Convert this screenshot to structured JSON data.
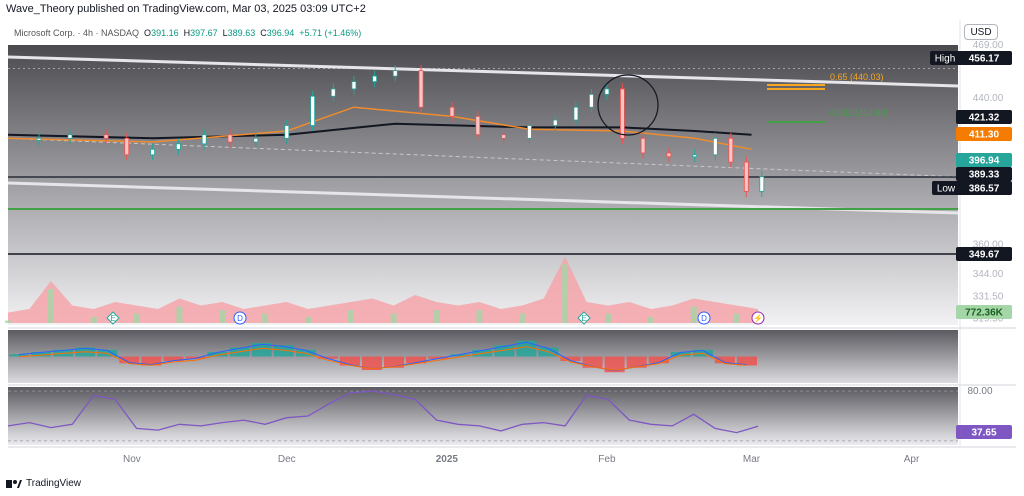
{
  "header": {
    "text": "Wave_Theory published on TradingView.com, Mar 03, 2025 03:09 UTC+2"
  },
  "currency_button": "USD",
  "legend": {
    "symbol": "Microsoft Corp. · 4h · NASDAQ",
    "o_label": "O",
    "o": "391.16",
    "h_label": "H",
    "h": "397.67",
    "l_label": "L",
    "l": "389.63",
    "c_label": "C",
    "c": "396.94",
    "change": "+5.71 (+1.46%)"
  },
  "footer": {
    "brand": "TradingView",
    "logo_text": "17"
  },
  "colors": {
    "up": "#26a69a",
    "down": "#ef5350",
    "ema": "#f08c2e",
    "sma": "#131722",
    "fib_gold": "#f5a623",
    "fib_green": "#43a047",
    "macd_line": "#2962ff",
    "signal_line": "#ff6d00",
    "rsi": "#7e57c2",
    "channel": "#d1d4dc"
  },
  "chart_data": [
    {
      "type": "line",
      "panel": "price",
      "title": "Microsoft Corp. 4h NASDAQ",
      "x_axis_labels": [
        "Nov",
        "Dec",
        "2025",
        "Feb",
        "Mar",
        "Apr"
      ],
      "x_axis_label_dates": [
        "2024-11-01",
        "2024-12-01",
        "2025-01-01",
        "2025-02-01",
        "2025-03-01",
        "2025-04-01"
      ],
      "y_axis_ticks": [
        "469.00",
        "440.00",
        "411.30",
        "396.94",
        "386.57",
        "360.00",
        "344.00",
        "331.50",
        "319.50"
      ],
      "ylim": [
        316,
        469
      ],
      "price_series": {
        "dates": [
          "2024-10-08",
          "2024-10-14",
          "2024-10-20",
          "2024-10-27",
          "2024-10-31",
          "2024-11-05",
          "2024-11-10",
          "2024-11-15",
          "2024-11-20",
          "2024-11-25",
          "2024-12-01",
          "2024-12-06",
          "2024-12-10",
          "2024-12-14",
          "2024-12-18",
          "2024-12-22",
          "2024-12-27",
          "2025-01-02",
          "2025-01-07",
          "2025-01-12",
          "2025-01-17",
          "2025-01-22",
          "2025-01-26",
          "2025-01-29",
          "2025-02-01",
          "2025-02-04",
          "2025-02-08",
          "2025-02-13",
          "2025-02-18",
          "2025-02-22",
          "2025-02-25",
          "2025-02-28",
          "2025-03-03"
        ],
        "close": [
          417,
          418,
          420,
          418,
          409,
          412,
          415,
          420,
          416,
          418,
          425,
          441,
          445,
          449,
          452,
          455,
          435,
          430,
          420,
          418,
          425,
          428,
          435,
          442,
          445,
          418,
          410,
          408,
          409,
          418,
          405,
          389,
          397
        ]
      },
      "ema_orange": {
        "dates": [
          "2024-10-08",
          "2024-11-05",
          "2024-12-01",
          "2024-12-14",
          "2025-01-02",
          "2025-01-17",
          "2025-02-04",
          "2025-02-18",
          "2025-03-01"
        ],
        "values": [
          418,
          416,
          422,
          435,
          430,
          423,
          422,
          418,
          412
        ]
      },
      "sma_black": {
        "dates": [
          "2024-10-08",
          "2024-11-05",
          "2024-12-01",
          "2024-12-22",
          "2025-01-17",
          "2025-02-04",
          "2025-02-18",
          "2025-03-01"
        ],
        "values": [
          420,
          418,
          420,
          426,
          424,
          424,
          422,
          420
        ]
      },
      "price_labels": [
        {
          "tag": "High",
          "value": "456.17"
        },
        {
          "tag": "",
          "value": "421.32"
        },
        {
          "tag": "",
          "value": "411.30"
        },
        {
          "tag": "",
          "value": "396.94"
        },
        {
          "tag": "",
          "value": "389.33"
        },
        {
          "tag": "Low",
          "value": "386.57"
        },
        {
          "tag": "",
          "value": "349.67"
        }
      ],
      "fib_levels": [
        {
          "label": "0.65 (440.03)",
          "value": 440.03
        },
        {
          "label": "0.382 (417.89)",
          "value": 417.89
        }
      ],
      "annotations": [
        "trend channel",
        "circle marker near Feb"
      ],
      "event_markers": [
        "E",
        "D",
        "E",
        "D"
      ]
    },
    {
      "type": "area",
      "panel": "volume",
      "last_value_label": "772.36K",
      "relative_values": [
        0.15,
        0.2,
        0.6,
        0.25,
        0.2,
        0.3,
        0.25,
        0.2,
        0.35,
        0.25,
        0.3,
        0.2,
        0.25,
        0.3,
        0.2,
        0.25,
        0.3,
        0.35,
        0.25,
        0.4,
        0.3,
        0.25,
        0.3,
        0.2,
        0.25,
        0.35,
        0.95,
        0.3,
        0.25,
        0.3,
        0.2,
        0.25,
        0.35,
        0.3,
        0.25,
        0.2
      ]
    },
    {
      "type": "bar",
      "panel": "macd",
      "relative_values": [
        0.1,
        0.2,
        0.3,
        0.4,
        0.3,
        -0.3,
        -0.4,
        -0.2,
        -0.1,
        0.2,
        0.4,
        0.6,
        0.5,
        0.3,
        -0.1,
        -0.4,
        -0.6,
        -0.5,
        -0.3,
        -0.1,
        0.1,
        0.3,
        0.5,
        0.7,
        0.4,
        -0.2,
        -0.5,
        -0.7,
        -0.5,
        -0.3,
        0.2,
        0.3,
        -0.3,
        -0.4
      ]
    },
    {
      "type": "line",
      "panel": "rsi",
      "levels": [
        "80.00",
        "37.65"
      ],
      "ylim": [
        15,
        85
      ],
      "x_index": [
        0,
        1,
        2,
        3,
        4,
        5,
        6,
        7,
        8,
        9,
        10,
        11,
        12,
        13,
        14,
        15,
        16,
        17,
        18,
        19,
        20,
        21,
        22,
        23,
        24,
        25,
        26,
        27,
        28,
        29,
        30,
        31,
        32,
        33,
        34,
        35
      ],
      "values": [
        38,
        42,
        36,
        40,
        75,
        70,
        35,
        33,
        40,
        38,
        42,
        45,
        40,
        48,
        50,
        65,
        78,
        80,
        76,
        70,
        45,
        40,
        38,
        32,
        40,
        42,
        38,
        75,
        70,
        45,
        40,
        38,
        52,
        35,
        30,
        37.65
      ]
    }
  ]
}
